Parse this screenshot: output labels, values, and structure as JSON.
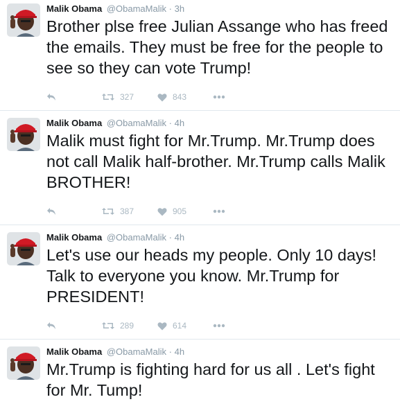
{
  "tweets": [
    {
      "name": "Malik Obama",
      "handle": "@ObamaMalik",
      "separator": "·",
      "time": "3h",
      "text": "Brother plse free Julian Assange who has freed the emails. They must be free for the people to see so they can vote Trump!",
      "retweets": "327",
      "likes": "843"
    },
    {
      "name": "Malik Obama",
      "handle": "@ObamaMalik",
      "separator": "·",
      "time": "4h",
      "text": "Malik must fight for Mr.Trump. Mr.Trump does not call Malik half-brother. Mr.Trump calls Malik BROTHER!",
      "retweets": "387",
      "likes": "905"
    },
    {
      "name": "Malik Obama",
      "handle": "@ObamaMalik",
      "separator": "·",
      "time": "4h",
      "text": "Let's use our heads my people. Only 10 days! Talk to everyone you know. Mr.Trump for PRESIDENT!",
      "retweets": "289",
      "likes": "614"
    },
    {
      "name": "Malik Obama",
      "handle": "@ObamaMalik",
      "separator": "·",
      "time": "4h",
      "text": "Mr.Trump is fighting hard for us all . Let's fight for Mr. Tump!"
    }
  ],
  "icons": {
    "reply": "reply-icon",
    "retweet": "retweet-icon",
    "like": "heart-icon",
    "more": "more-icon"
  },
  "colors": {
    "action_gray": "#aab8c2",
    "meta_gray": "#8899a6",
    "divider": "#e1e8ed",
    "hat_red": "#d01a25"
  }
}
